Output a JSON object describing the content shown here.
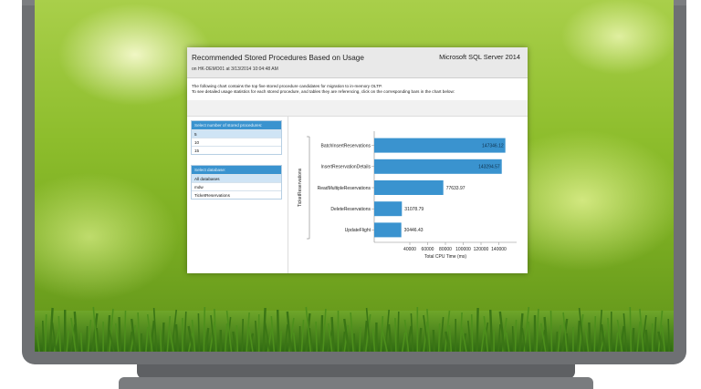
{
  "window": {
    "title": "Recommended Stored Procedures Based on Usage",
    "subtitle": "on HK-DEMO01 at 3/13/2014 10:04:48 AM",
    "brand": "Microsoft SQL Server 2014",
    "desc_line1": "The following chart contains the top five stored procedure candidates for migration to in-memory OLTP.",
    "desc_line2": "To see detailed usage statistics for each stored procedure, and tables they are referencing, click on the corresponding bars in the chart below:"
  },
  "proc_count_panel": {
    "header": "Select number of stored procedures:",
    "items": [
      "5",
      "10",
      "15"
    ],
    "selected": "5"
  },
  "database_panel": {
    "header": "Select database:",
    "items": [
      "All databases",
      "mdw",
      "TicketReservations"
    ],
    "selected": "All databases"
  },
  "colors": {
    "bar": "#3a93cf",
    "panel_header": "#3a93cf",
    "selected_row": "#cfe4f5"
  },
  "chart_data": {
    "type": "bar",
    "orientation": "horizontal",
    "categories": [
      "BatchInsertReservations",
      "InsertReservationDetails",
      "ReadMultipleReservations",
      "DeleteReservations",
      "UpdateFlight"
    ],
    "values": [
      147346.12,
      143294.57,
      77633.97,
      31078.79,
      30446.43
    ],
    "value_labels": [
      "147346.12",
      "143294.57",
      "77633.97",
      "31078.79",
      "30446.43"
    ],
    "xlabel": "Total CPU Time (ms)",
    "ylabel": "TicketReservations",
    "xlim": [
      0,
      160000
    ],
    "xticks": [
      40000,
      60000,
      80000,
      100000,
      120000,
      140000
    ],
    "xtick_labels": [
      "40000",
      "60000",
      "80000",
      "100000",
      "120000",
      "140000"
    ],
    "grid": false
  }
}
